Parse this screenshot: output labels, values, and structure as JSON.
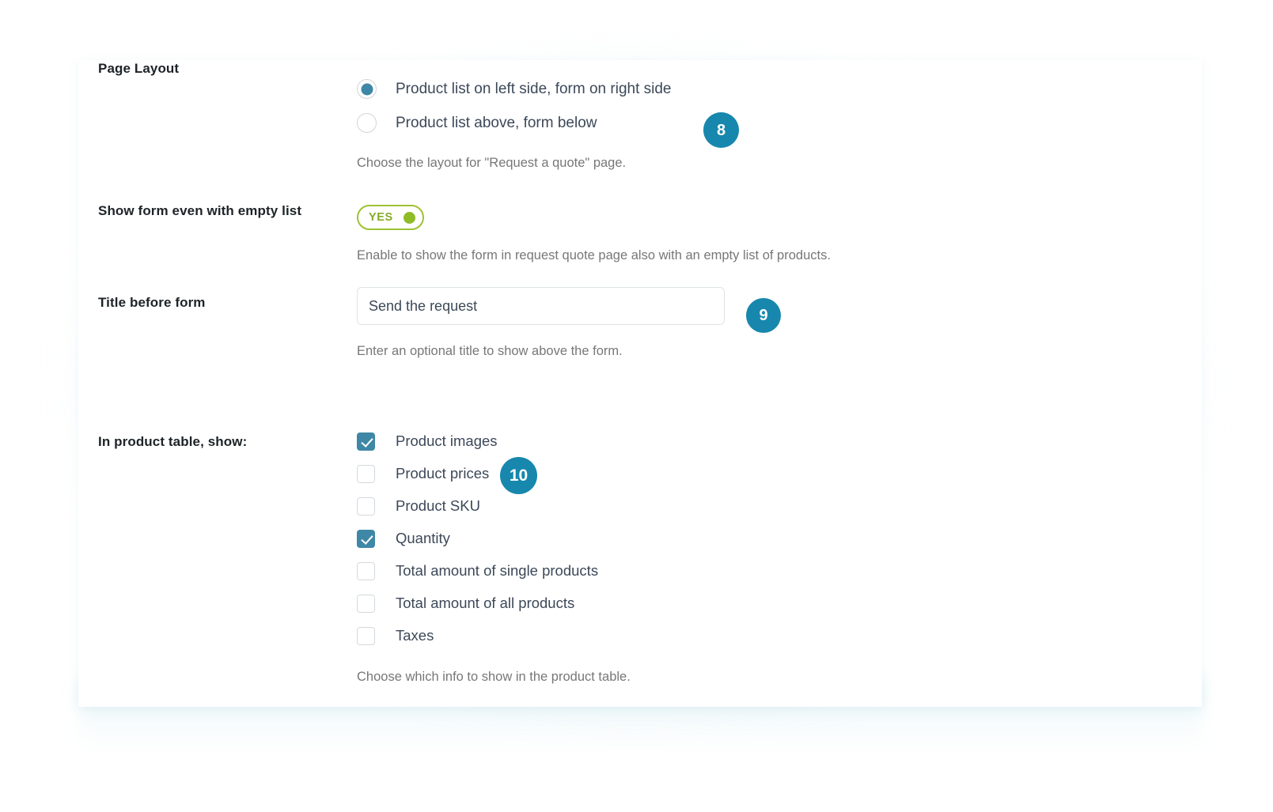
{
  "settings": {
    "page_layout": {
      "label": "Page Layout",
      "options": [
        {
          "label": "Product list on left side, form on right side",
          "checked": true
        },
        {
          "label": "Product list above, form below",
          "checked": false
        }
      ],
      "hint": "Choose the layout for \"Request a quote\" page."
    },
    "show_form_empty_list": {
      "label": "Show form even with empty list",
      "toggle_value": "YES",
      "hint": "Enable to show the form in request quote page also with an empty list of products."
    },
    "title_before_form": {
      "label": "Title before form",
      "value": "Send the request",
      "placeholder": "Send the request",
      "hint": "Enter an optional title to show above the form."
    },
    "product_table_show": {
      "label": "In product table, show:",
      "options": [
        {
          "label": "Product images",
          "checked": true
        },
        {
          "label": "Product prices",
          "checked": false
        },
        {
          "label": "Product SKU",
          "checked": false
        },
        {
          "label": "Quantity",
          "checked": true
        },
        {
          "label": "Total amount of single products",
          "checked": false
        },
        {
          "label": "Total amount of all products",
          "checked": false
        },
        {
          "label": "Taxes",
          "checked": false
        }
      ],
      "hint": "Choose which info to show in the product table."
    }
  },
  "badges": [
    {
      "number": "8"
    },
    {
      "number": "9"
    },
    {
      "number": "10"
    }
  ],
  "colors": {
    "accent_teal": "#3f87a6",
    "badge_teal": "#1787ad",
    "toggle_green": "#8fbb27",
    "label_dark": "#1d2327",
    "hint_gray": "#777777"
  }
}
